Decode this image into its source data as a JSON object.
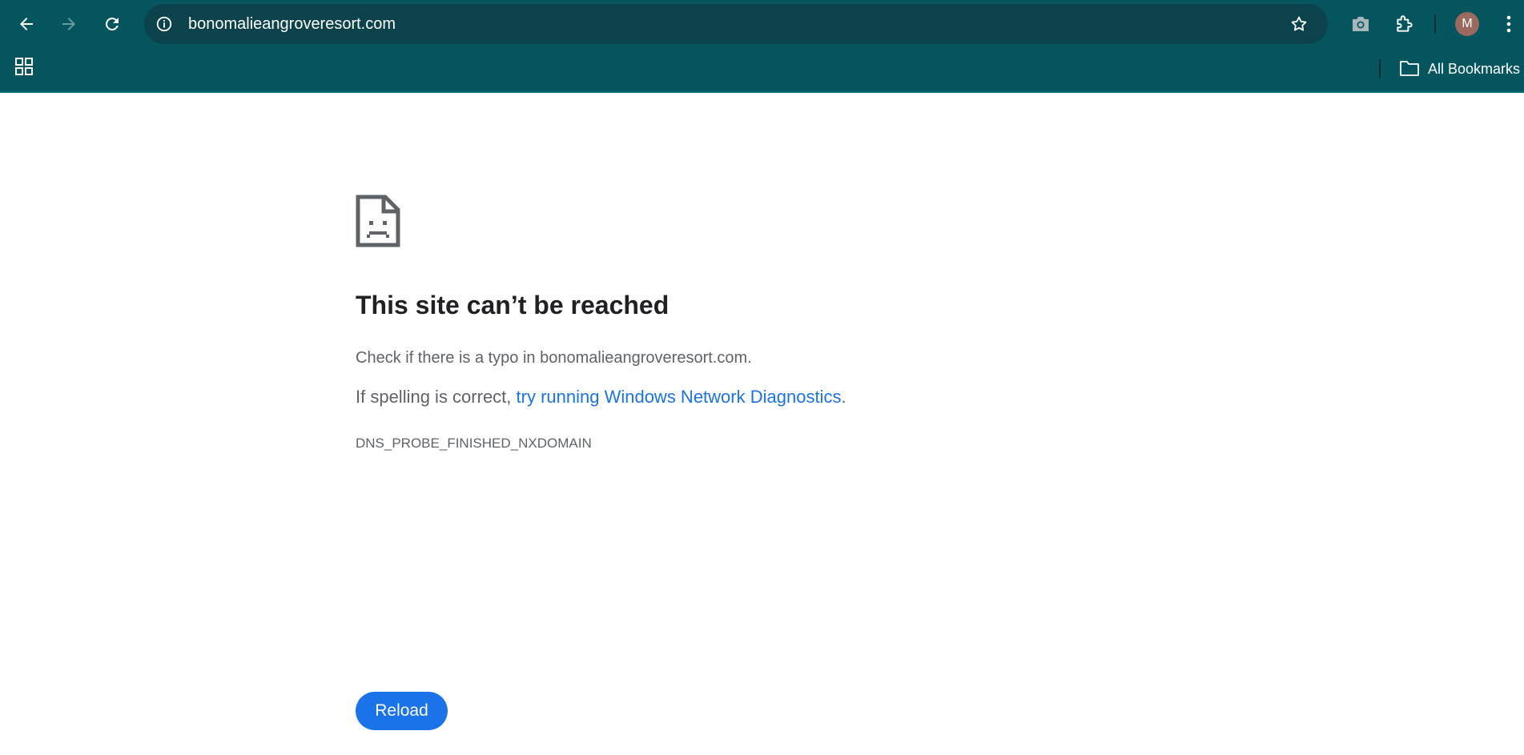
{
  "browser": {
    "url": "bonomalieangroveresort.com",
    "avatar_letter": "M",
    "bookmarks_label": "All Bookmarks",
    "icons": {
      "back": "arrow-left-icon",
      "forward": "arrow-right-icon",
      "reload": "reload-icon",
      "site_info": "info-icon",
      "bookmark_star": "star-icon",
      "screenshot": "camera-icon",
      "extensions": "puzzle-icon",
      "menu": "kebab-menu-icon",
      "apps": "apps-grid-icon",
      "folder": "folder-icon"
    },
    "colors": {
      "toolbar_bg": "#04555e",
      "omnibox_bg": "#0c424b"
    }
  },
  "error_page": {
    "icon": "sad-file-icon",
    "title": "This site can’t be reached",
    "typo_message": "Check if there is a typo in bonomalieangroveresort.com.",
    "spelling_prefix": "If spelling is correct, ",
    "diagnostics_link": "try running Windows Network Diagnostics",
    "spelling_suffix": ".",
    "error_code": "DNS_PROBE_FINISHED_NXDOMAIN",
    "reload_label": "Reload",
    "colors": {
      "link": "#1a73e8",
      "button_bg": "#1a73e8",
      "title": "#202124",
      "body_text": "#5f6368"
    }
  }
}
